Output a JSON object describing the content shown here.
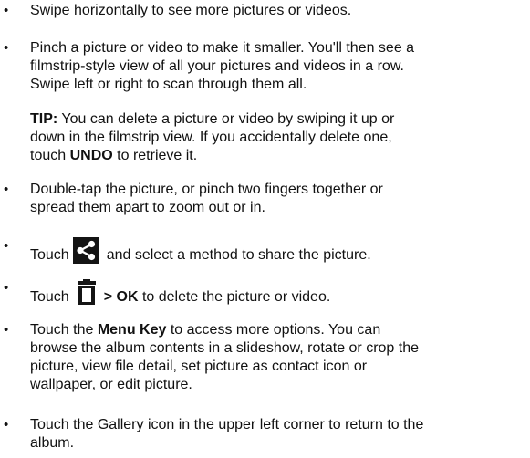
{
  "items": [
    {
      "text": "Swipe horizontally to see more pictures or videos."
    },
    {
      "lines": [
        "Pinch a picture or video to make it smaller. You'll then see a",
        "filmstrip-style view of all your pictures and videos in a row.",
        "Swipe left or right to scan through them all."
      ]
    },
    {
      "tip": {
        "label": "TIP:",
        "line1_rest": " You can delete a picture or video by swiping it up or",
        "line2": "down in the filmstrip view. If you accidentally delete one,",
        "line3_pre": "touch ",
        "line3_bold": "UNDO",
        "line3_post": " to retrieve it."
      }
    },
    {
      "lines": [
        "Double-tap the picture, or pinch two fingers together or",
        "spread them apart to zoom out or in."
      ]
    },
    {
      "pre": "Touch",
      "icon": "share-icon",
      "post": "and select a method to share the picture."
    },
    {
      "pre": "Touch",
      "icon": "trash-icon",
      "bold": "> OK",
      "post": " to delete the picture or video."
    },
    {
      "line1_pre": "Touch the ",
      "line1_bold": "Menu Key",
      "line1_post": " to access more options. You can",
      "lines": [
        "browse the album contents in a slideshow, rotate or crop the",
        "picture, view file detail, set picture as contact icon or",
        "wallpaper, or edit picture."
      ]
    },
    {
      "lines": [
        "Touch the Gallery icon in the upper left corner to return to the",
        "album."
      ]
    }
  ],
  "bullet": "•"
}
